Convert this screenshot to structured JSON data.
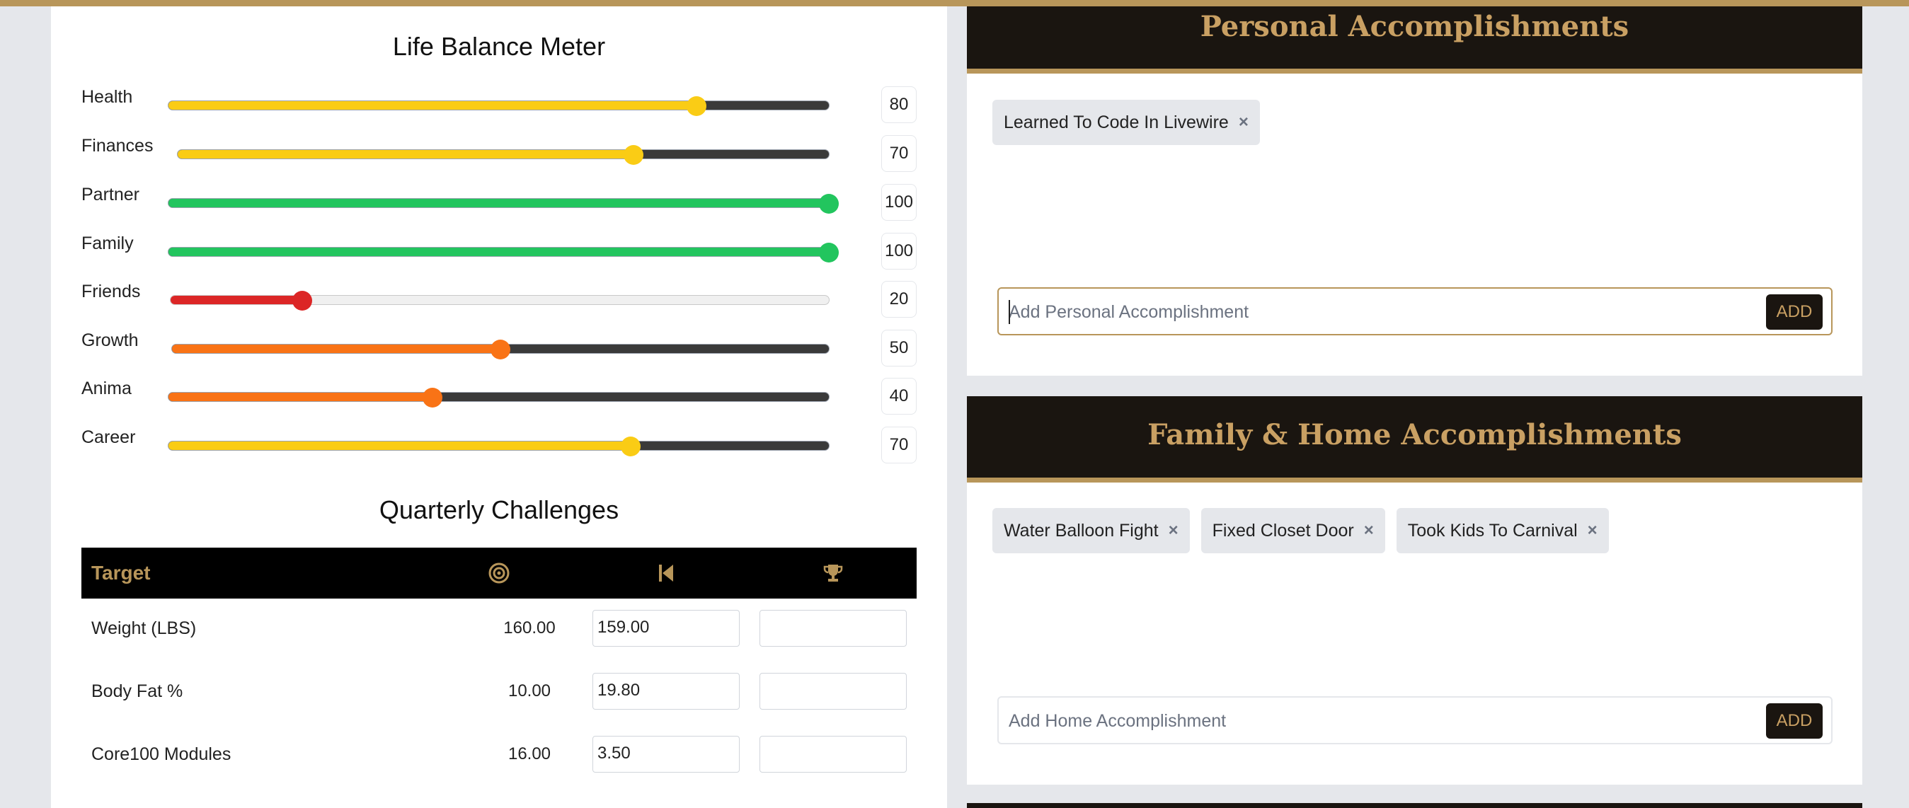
{
  "colors": {
    "accent": "#b8965a",
    "header_bg": "#1a1510",
    "yellow": "#facc15",
    "green": "#22c55e",
    "red": "#dc2626",
    "orange": "#f97316",
    "track_dark": "#3a3a3a"
  },
  "meter": {
    "title": "Life Balance Meter",
    "items": [
      {
        "label": "Health",
        "value": "80",
        "level": 80,
        "color": "#facc15"
      },
      {
        "label": "Finances",
        "value": "70",
        "level": 70,
        "color": "#facc15"
      },
      {
        "label": "Partner",
        "value": "100",
        "level": 100,
        "color": "#22c55e"
      },
      {
        "label": "Family",
        "value": "100",
        "level": 100,
        "color": "#22c55e"
      },
      {
        "label": "Friends",
        "value": "20",
        "level": 20,
        "color": "#dc2626"
      },
      {
        "label": "Growth",
        "value": "50",
        "level": 50,
        "color": "#f97316"
      },
      {
        "label": "Anima",
        "value": "40",
        "level": 40,
        "color": "#f97316"
      },
      {
        "label": "Career",
        "value": "70",
        "level": 70,
        "color": "#facc15"
      }
    ]
  },
  "challenges": {
    "title": "Quarterly Challenges",
    "header_target": "Target",
    "header_icons": [
      "target-icon",
      "skip-back-icon",
      "trophy-icon"
    ],
    "rows": [
      {
        "name": "Weight (LBS)",
        "target": "160.00",
        "start": "159.00",
        "achieved": ""
      },
      {
        "name": "Body Fat %",
        "target": "10.00",
        "start": "19.80",
        "achieved": ""
      },
      {
        "name": "Core100 Modules",
        "target": "16.00",
        "start": "3.50",
        "achieved": ""
      }
    ]
  },
  "personal": {
    "title": "Personal Accomplishments",
    "chips": [
      "Learned To Code In Livewire"
    ],
    "remove_symbol": "×",
    "placeholder": "Add Personal Accomplishment",
    "add_label": "ADD"
  },
  "family": {
    "title": "Family & Home Accomplishments",
    "chips": [
      "Water Balloon Fight",
      "Fixed Closet Door",
      "Took Kids To Carnival"
    ],
    "remove_symbol": "×",
    "placeholder": "Add Home Accomplishment",
    "add_label": "ADD"
  }
}
